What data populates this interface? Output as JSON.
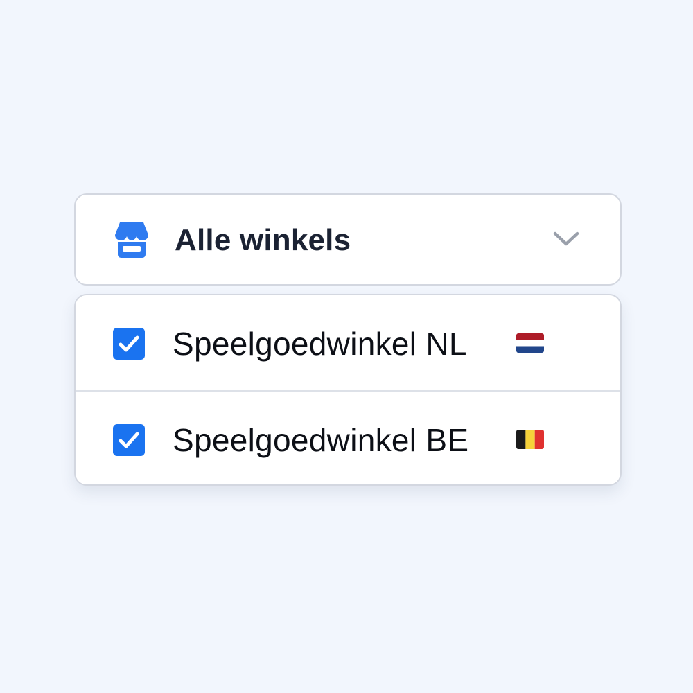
{
  "store_select": {
    "icon": "store-icon",
    "label": "Alle winkels",
    "accent_color": "#2f7bf0",
    "chevron_icon": "chevron-down-icon"
  },
  "options": [
    {
      "label": "Speelgoedwinkel NL",
      "checked": true,
      "flag": "netherlands-flag-icon"
    },
    {
      "label": "Speelgoedwinkel BE",
      "checked": true,
      "flag": "belgium-flag-icon"
    }
  ],
  "colors": {
    "checkbox": "#1a73f0",
    "background": "#f2f6fd"
  }
}
